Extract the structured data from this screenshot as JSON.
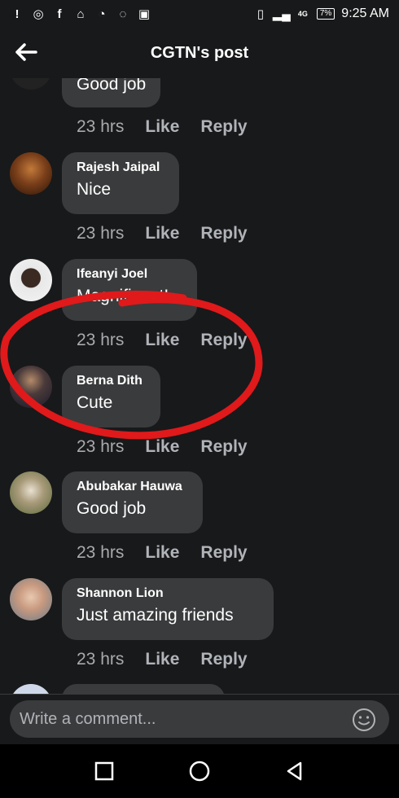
{
  "status_bar": {
    "time": "9:25 AM",
    "battery": "7%",
    "network": "4G"
  },
  "header": {
    "title": "CGTN's post"
  },
  "comments": [
    {
      "author": "",
      "text": "Good  job",
      "time": "23 hrs",
      "like": "Like",
      "reply": "Reply"
    },
    {
      "author": "Rajesh Jaipal",
      "text": "Nice",
      "time": "23 hrs",
      "like": "Like",
      "reply": "Reply"
    },
    {
      "author": "Ifeanyi Joel",
      "text": "Magnificent!",
      "time": "23 hrs",
      "like": "Like",
      "reply": "Reply"
    },
    {
      "author": "Berna Dith",
      "text": "Cute",
      "time": "23 hrs",
      "like": "Like",
      "reply": "Reply"
    },
    {
      "author": "Abubakar Hauwa",
      "text": "Good job",
      "time": "23 hrs",
      "like": "Like",
      "reply": "Reply"
    },
    {
      "author": "Shannon Lion",
      "text": "Just amazing friends",
      "time": "23 hrs",
      "like": "Like",
      "reply": "Reply"
    }
  ],
  "composer": {
    "placeholder": "Write a comment..."
  },
  "colors": {
    "background": "#18191a",
    "bubble": "#3a3b3c",
    "annotation": "#e0191b"
  },
  "icons": [
    "back-arrow-icon",
    "emoji-icon",
    "recent-apps-icon",
    "home-icon",
    "back-nav-icon"
  ]
}
